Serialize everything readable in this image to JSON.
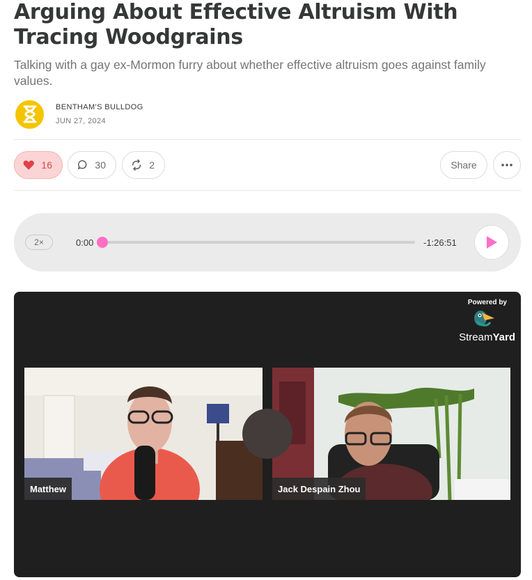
{
  "post": {
    "title": "Arguing About Effective Altruism With Tracing Woodgrains",
    "subtitle": "Talking with a gay ex-Mormon furry about whether effective altruism goes against family values.",
    "author": "BENTHAM'S BULLDOG",
    "date": "JUN 27, 2024"
  },
  "actions": {
    "likes": "16",
    "comments": "30",
    "restacks": "2",
    "share_label": "Share"
  },
  "player": {
    "speed": "2×",
    "current_time": "0:00",
    "remaining_time": "-1:26:51",
    "progress": 0
  },
  "video": {
    "powered_by": "Powered by",
    "brand_light": "Stream",
    "brand_bold": "Yard",
    "participants": [
      "Matthew",
      "Jack Despain Zhou"
    ]
  },
  "colors": {
    "accent_pink": "#ff6fc4",
    "like_bg": "#fbd5d5",
    "avatar_yellow": "#f5c400"
  },
  "icons": [
    "heart-icon",
    "comment-icon",
    "restack-icon",
    "more-icon",
    "play-icon",
    "hourglass-icon"
  ]
}
